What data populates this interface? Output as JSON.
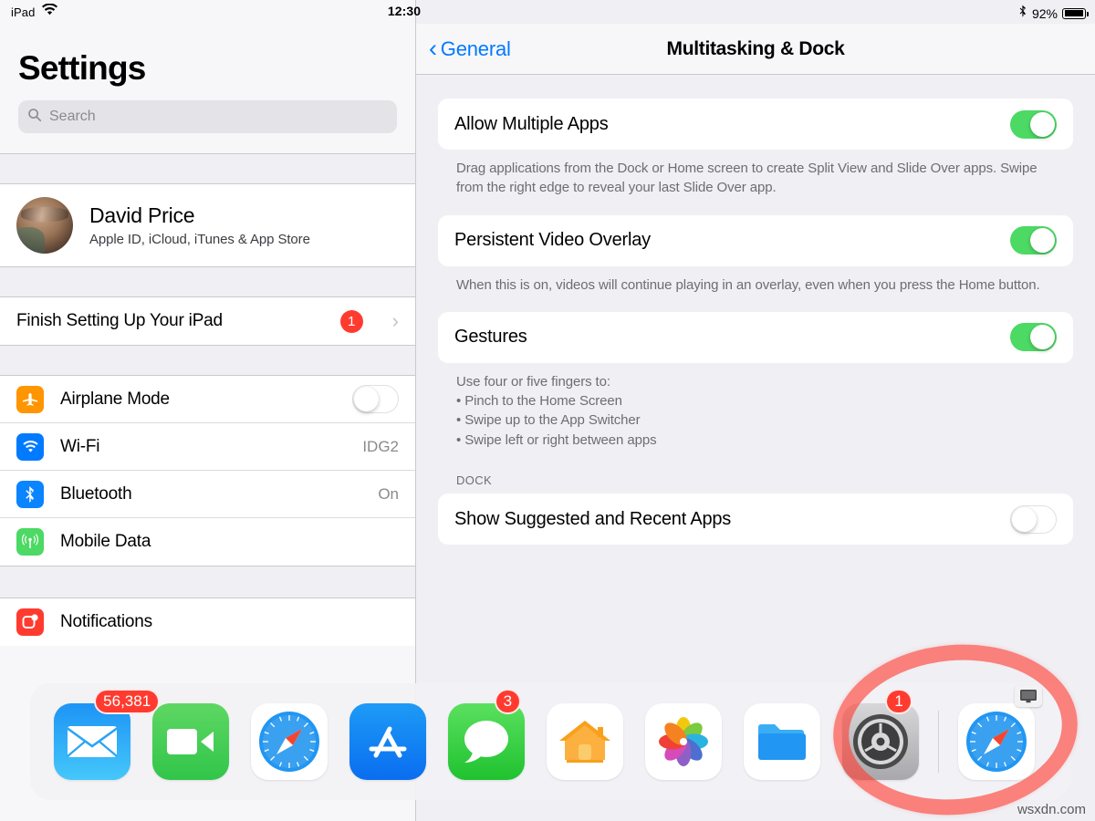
{
  "sidebar": {
    "status": {
      "carrier": "iPad",
      "wifi_icon": "wifi-icon"
    },
    "title": "Settings",
    "search": {
      "placeholder": "Search",
      "icon": "search-icon"
    },
    "profile": {
      "name": "David Price",
      "subtitle": "Apple ID, iCloud, iTunes & App Store",
      "avatar": "avatar-image"
    },
    "setup_row": {
      "label": "Finish Setting Up Your iPad",
      "badge": "1",
      "chevron": "chevron-right-icon"
    },
    "rows": [
      {
        "label": "Airplane Mode",
        "icon": "airplane-icon",
        "control": "toggle",
        "on": false
      },
      {
        "label": "Wi-Fi",
        "icon": "wifi-icon",
        "control": "value",
        "value": "IDG2"
      },
      {
        "label": "Bluetooth",
        "icon": "bluetooth-icon",
        "control": "value",
        "value": "On"
      },
      {
        "label": "Mobile Data",
        "icon": "cellular-icon",
        "control": "value",
        "value": ""
      }
    ],
    "partial_row": {
      "label": "Notifications",
      "icon": "notifications-icon"
    }
  },
  "main": {
    "status": {
      "clock": "12:30",
      "bluetooth_icon": "bluetooth-icon",
      "battery_percent": "92%",
      "battery_icon": "battery-full-icon"
    },
    "nav": {
      "back_label": "General",
      "back_icon": "chevron-left-icon",
      "title": "Multitasking & Dock"
    },
    "sections": [
      {
        "row_label": "Allow Multiple Apps",
        "toggle_on": true,
        "footnote": "Drag applications from the Dock or Home screen to create Split View and Slide Over apps. Swipe from the right edge to reveal your last Slide Over app."
      },
      {
        "row_label": "Persistent Video Overlay",
        "toggle_on": true,
        "footnote": "When this is on, videos will continue playing in an overlay, even when you press the Home button."
      },
      {
        "row_label": "Gestures",
        "toggle_on": true,
        "footnote": "Use four or five fingers to:\n• Pinch to the Home Screen\n• Swipe up to the App Switcher\n• Swipe left or right between apps"
      }
    ],
    "dock_section": {
      "header": "DOCK",
      "row_label": "Show Suggested and Recent Apps",
      "toggle_on": false
    }
  },
  "dock": {
    "apps": [
      {
        "name": "Mail",
        "icon": "mail-icon",
        "badge": "56,381"
      },
      {
        "name": "FaceTime",
        "icon": "facetime-icon",
        "badge": ""
      },
      {
        "name": "Safari",
        "icon": "safari-icon",
        "badge": ""
      },
      {
        "name": "App Store",
        "icon": "app-store-icon",
        "badge": ""
      },
      {
        "name": "Messages",
        "icon": "messages-icon",
        "badge": "3"
      },
      {
        "name": "Home",
        "icon": "home-icon",
        "badge": ""
      },
      {
        "name": "Photos",
        "icon": "photos-icon",
        "badge": ""
      },
      {
        "name": "Files",
        "icon": "files-icon",
        "badge": ""
      },
      {
        "name": "Settings",
        "icon": "settings-gear-icon",
        "badge": "1"
      }
    ],
    "recent": {
      "name": "Safari",
      "icon": "safari-icon",
      "status_badge": "display-icon"
    }
  },
  "annotation": {
    "shape": "red-circle-highlight"
  },
  "watermark": "wsxdn.com",
  "colors": {
    "accent_blue": "#007AFF",
    "toggle_green": "#4CD964",
    "badge_red": "#FF3B30",
    "background": "#EFEFF4",
    "annotation_red": "#FF3B30"
  }
}
